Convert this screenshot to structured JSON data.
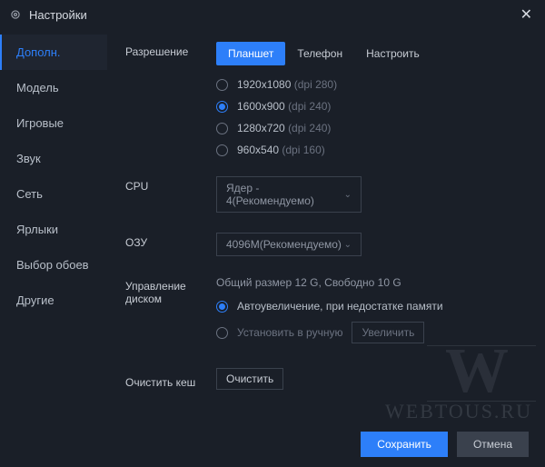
{
  "window": {
    "title": "Настройки"
  },
  "sidebar": {
    "items": [
      {
        "label": "Дополн.",
        "active": true
      },
      {
        "label": "Модель",
        "active": false
      },
      {
        "label": "Игровые",
        "active": false
      },
      {
        "label": "Звук",
        "active": false
      },
      {
        "label": "Сеть",
        "active": false
      },
      {
        "label": "Ярлыки",
        "active": false
      },
      {
        "label": "Выбор обоев",
        "active": false
      },
      {
        "label": "Другие",
        "active": false
      }
    ]
  },
  "resolution": {
    "label": "Разрешение",
    "tabs": [
      {
        "label": "Планшет",
        "active": true
      },
      {
        "label": "Телефон",
        "active": false
      },
      {
        "label": "Настроить",
        "active": false
      }
    ],
    "options": [
      {
        "res": "1920x1080",
        "dpi": "(dpi 280)",
        "selected": false
      },
      {
        "res": "1600x900",
        "dpi": "(dpi 240)",
        "selected": true
      },
      {
        "res": "1280x720",
        "dpi": "(dpi 240)",
        "selected": false
      },
      {
        "res": "960x540",
        "dpi": "(dpi 160)",
        "selected": false
      }
    ]
  },
  "cpu": {
    "label": "CPU",
    "value": "Ядер - 4(Рекомендуемо)"
  },
  "ram": {
    "label": "ОЗУ",
    "value": "4096M(Рекомендуемо)"
  },
  "disk": {
    "label": "Управление диском",
    "summary": "Общий размер 12 G,  Свободно 10 G",
    "opt_auto": "Автоувеличение, при недостатке памяти",
    "opt_manual": "Установить в ручную",
    "enlarge_btn": "Увеличить",
    "auto_selected": true
  },
  "cache": {
    "label": "Очистить кеш",
    "btn": "Очистить"
  },
  "footer": {
    "save": "Сохранить",
    "cancel": "Отмена"
  },
  "watermark": {
    "text": "WEBTOUS.RU",
    "glyph": "W"
  }
}
